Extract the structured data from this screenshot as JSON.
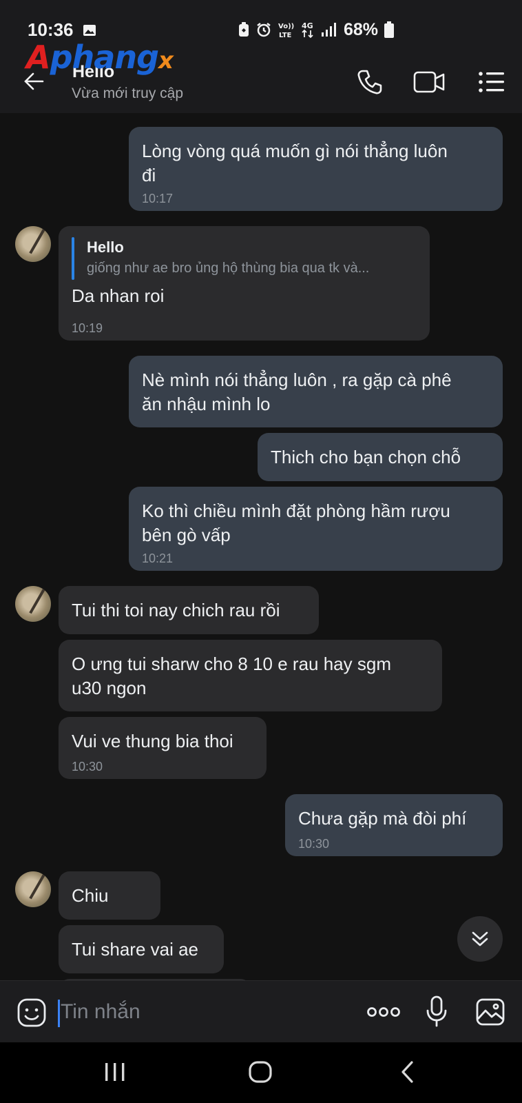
{
  "status_bar": {
    "time": "10:36",
    "battery_text": "68%",
    "icons": [
      "image-icon",
      "battery-saver-icon",
      "alarm-icon",
      "volte-icon",
      "4g-icon",
      "signal-icon",
      "battery-icon"
    ]
  },
  "watermark": {
    "p1": "A",
    "p2": "phang",
    "p3": "x"
  },
  "header": {
    "contact_name": "Hello",
    "contact_status": "Vừa mới truy cập",
    "icons": [
      "back-arrow-icon",
      "phone-icon",
      "video-call-icon",
      "menu-icon"
    ]
  },
  "messages": [
    {
      "id": "m1",
      "dir": "out",
      "lines": [
        "Lòng vòng quá muốn gì nói thẳng luôn",
        "đi"
      ],
      "time": "10:17"
    },
    {
      "id": "m2",
      "dir": "in",
      "quote": {
        "name": "Hello",
        "text": "giống như ae bro ủng hộ thùng bia qua tk và..."
      },
      "lines": [
        "Da nhan roi"
      ],
      "time": "10:19"
    },
    {
      "id": "m3",
      "dir": "out",
      "lines": [
        "Nè mình nói thẳng luôn , ra gặp cà phê",
        "ăn nhậu mình lo"
      ]
    },
    {
      "id": "m4",
      "dir": "out",
      "lines": [
        "Thich cho bạn chọn chỗ"
      ]
    },
    {
      "id": "m5",
      "dir": "out",
      "lines": [
        "Ko thì chiều mình đặt phòng hầm rượu",
        "bên gò vấp"
      ],
      "time": "10:21"
    },
    {
      "id": "m6",
      "dir": "in",
      "lines": [
        "Tui thi toi nay chich rau rồi"
      ]
    },
    {
      "id": "m7",
      "dir": "in",
      "lines": [
        "O ưng tui sharw cho 8 10 e rau hay sgm",
        "u30 ngon"
      ]
    },
    {
      "id": "m8",
      "dir": "in",
      "lines": [
        "Vui ve thung bia thoi"
      ],
      "time": "10:30"
    },
    {
      "id": "m9",
      "dir": "out",
      "lines": [
        "Chưa gặp mà đòi phí"
      ],
      "time": "10:30"
    },
    {
      "id": "m10",
      "dir": "in",
      "lines": [
        "Chiu"
      ]
    },
    {
      "id": "m11",
      "dir": "in",
      "lines": [
        "Tui share vai ae"
      ]
    }
  ],
  "input_bar": {
    "placeholder": "Tin nhắn",
    "icons": [
      "sticker-icon",
      "more-options-icon",
      "microphone-icon",
      "gallery-icon"
    ]
  },
  "nav_bar": {
    "icons": [
      "recent-apps-icon",
      "home-icon",
      "back-icon"
    ]
  },
  "colors": {
    "background": "#121212",
    "outgoing_bubble": "#38404b",
    "incoming_bubble": "#2b2b2d",
    "accent": "#2a84e6"
  }
}
